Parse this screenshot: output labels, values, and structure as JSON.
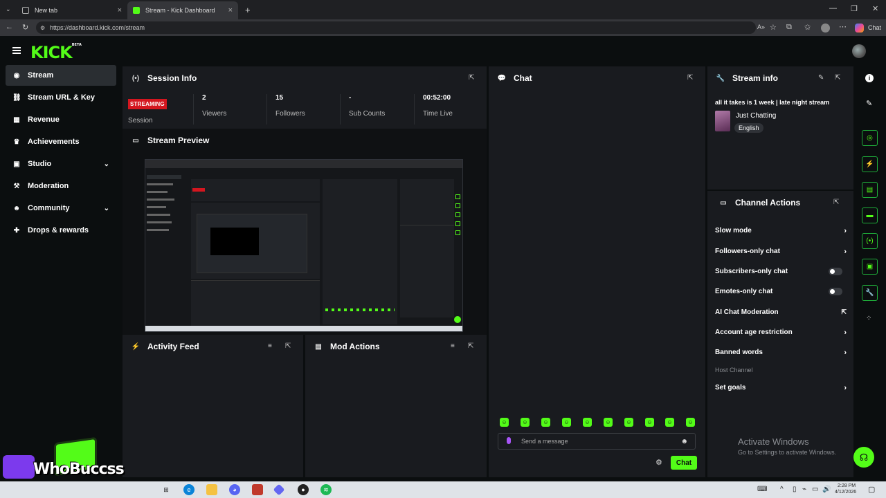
{
  "browser": {
    "tabs": [
      {
        "title": "New tab",
        "active": false
      },
      {
        "title": "Stream - Kick Dashboard",
        "active": true
      }
    ],
    "url": "https://dashboard.kick.com/stream",
    "chat_label": "Chat"
  },
  "app": {
    "logo": "KICK",
    "logo_sup": "BETA"
  },
  "sidebar": {
    "items": [
      {
        "label": "Stream",
        "icon": "broadcast-icon",
        "active": true,
        "has_chevron": false
      },
      {
        "label": "Stream URL & Key",
        "icon": "link-icon",
        "active": false,
        "has_chevron": false
      },
      {
        "label": "Revenue",
        "icon": "bank-icon",
        "active": false,
        "has_chevron": false
      },
      {
        "label": "Achievements",
        "icon": "trophy-icon",
        "active": false,
        "has_chevron": false
      },
      {
        "label": "Studio",
        "icon": "studio-icon",
        "active": false,
        "has_chevron": true
      },
      {
        "label": "Moderation",
        "icon": "gavel-icon",
        "active": false,
        "has_chevron": false
      },
      {
        "label": "Community",
        "icon": "people-icon",
        "active": false,
        "has_chevron": true
      },
      {
        "label": "Drops & rewards",
        "icon": "gift-icon",
        "active": false,
        "has_chevron": false
      }
    ]
  },
  "session_info": {
    "title": "Session Info",
    "status_badge": "STREAMING",
    "status_label": "Session",
    "stats": [
      {
        "value": "2",
        "label": "Viewers"
      },
      {
        "value": "15",
        "label": "Followers"
      },
      {
        "value": "-",
        "label": "Sub Counts"
      },
      {
        "value": "00:52:00",
        "label": "Time Live"
      }
    ]
  },
  "stream_preview": {
    "title": "Stream Preview"
  },
  "activity_feed": {
    "title": "Activity Feed"
  },
  "mod_actions": {
    "title": "Mod Actions"
  },
  "chat": {
    "title": "Chat",
    "input_placeholder": "Send a message",
    "send_label": "Chat",
    "emote_count": 10
  },
  "stream_info": {
    "title": "Stream info",
    "stream_title": "all it takes is 1 week | late night stream",
    "category": "Just Chatting",
    "language": "English"
  },
  "channel_actions": {
    "title": "Channel Actions",
    "items": [
      {
        "label": "Slow mode",
        "control": "chevron"
      },
      {
        "label": "Followers-only chat",
        "control": "chevron"
      },
      {
        "label": "Subscribers-only chat",
        "control": "toggle"
      },
      {
        "label": "Emotes-only chat",
        "control": "toggle"
      },
      {
        "label": "AI Chat Moderation",
        "control": "external"
      },
      {
        "label": "Account age restriction",
        "control": "chevron"
      },
      {
        "label": "Banned words",
        "control": "chevron"
      },
      {
        "label": "Host Channel",
        "control": "none"
      },
      {
        "label": "Set goals",
        "control": "chevron"
      }
    ]
  },
  "watermark": {
    "line1": "Activate Windows",
    "line2": "Go to Settings to activate Windows."
  },
  "overlay": {
    "name": "WhoBuccss"
  },
  "taskbar": {
    "time": "2:28 PM",
    "date": "4/12/2026"
  },
  "colors": {
    "accent": "#53fc18",
    "live": "#d4161f",
    "panel": "#191b1f",
    "background": "#0b0e0f"
  }
}
